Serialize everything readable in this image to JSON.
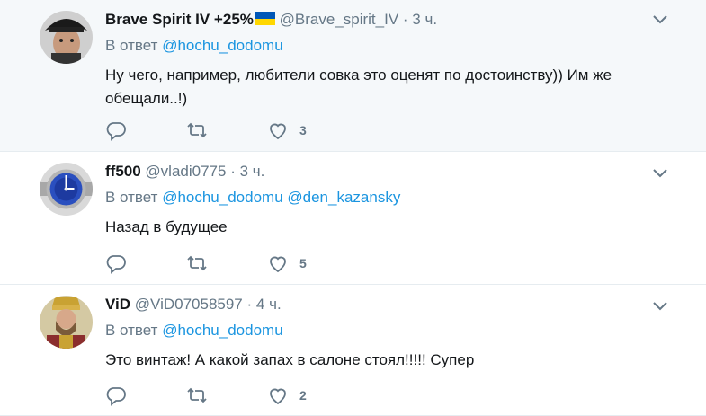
{
  "tweets": [
    {
      "name": "Brave Spirit IV +25%",
      "handle": "@Brave_spirit_IV",
      "time": "3 ч.",
      "reply_prefix": "В ответ",
      "mentions": [
        "@hochu_dodomu"
      ],
      "text_lines": [
        "Ну чего, например, любители совка это оценят по достоинству)) Им же",
        "обещали..!)"
      ],
      "likes": "3"
    },
    {
      "name": "ff500",
      "handle": "@vladi0775",
      "time": "3 ч.",
      "reply_prefix": "В ответ",
      "mentions": [
        "@hochu_dodomu",
        "@den_kazansky"
      ],
      "text_lines": [
        "Назад в будущее"
      ],
      "likes": "5"
    },
    {
      "name": "ViD",
      "handle": "@ViD07058597",
      "time": "4 ч.",
      "reply_prefix": "В ответ",
      "mentions": [
        "@hochu_dodomu"
      ],
      "text_lines": [
        "Это винтаж! А какой запах в салоне стоял!!!!! Супер"
      ],
      "likes": "2"
    }
  ],
  "separator": "·",
  "icons": {
    "reply": "reply-icon",
    "retweet": "retweet-icon",
    "like": "heart-icon",
    "menu": "chevron-down-icon",
    "flag": "ukraine-flag-icon"
  },
  "colors": {
    "link": "#1b95e0",
    "muted": "#657786",
    "highlight_bg": "#f5f8fa",
    "border": "#e6ecf0"
  }
}
